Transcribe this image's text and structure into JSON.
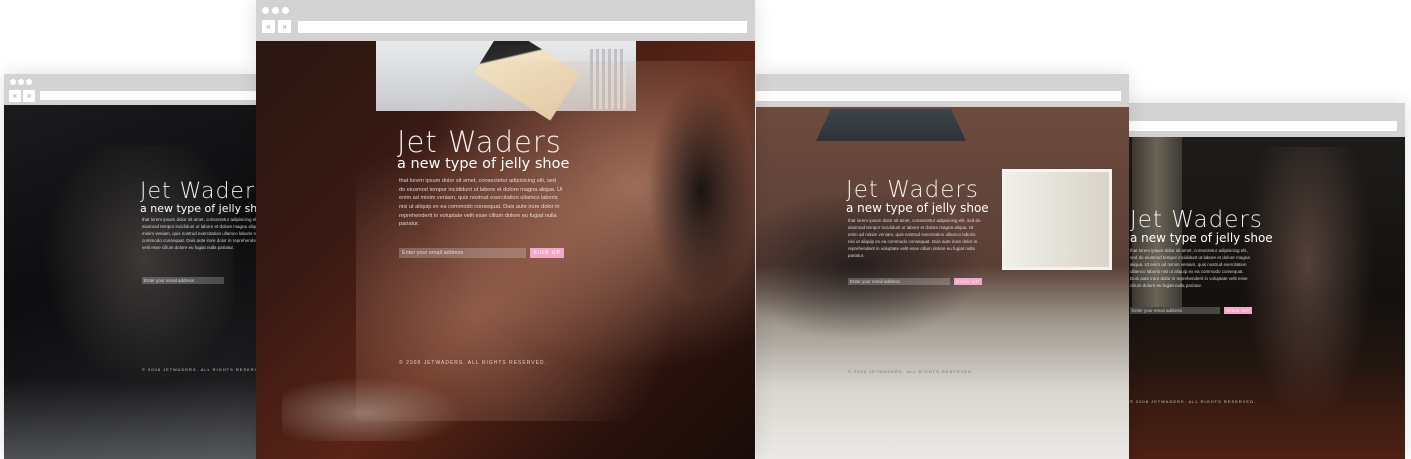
{
  "site": {
    "brand": "Jet Waders",
    "tagline": "a new type of jelly shoe",
    "body_text": "that lorem ipsum dolor sit amet, consectetur adipisicing elit, sed do eiusmod tempor incididunt ut labore et dolore magna aliqua. Ut enim ad minim veniam, quis nostrud exercitation ullamco laboris nisi ut aliquip ex ea commodo consequat. Duis aute irure dolor in reprehenderit in voluptate velit esse cillum dolore eu fugiat nulla pariatur.",
    "email_placeholder": "Enter your email address",
    "signup_label": "SIGN UP",
    "footer": "© 2008 JETWADERS. ALL RIGHTS RESERVED."
  },
  "browser": {
    "back_glyph": "«",
    "forward_glyph": "»"
  },
  "colors": {
    "chrome": "#d3d3d3",
    "signup_button": "#f3a8c9"
  },
  "icons": [
    "window-dot-icon",
    "back-arrow-icon",
    "forward-arrow-icon"
  ]
}
